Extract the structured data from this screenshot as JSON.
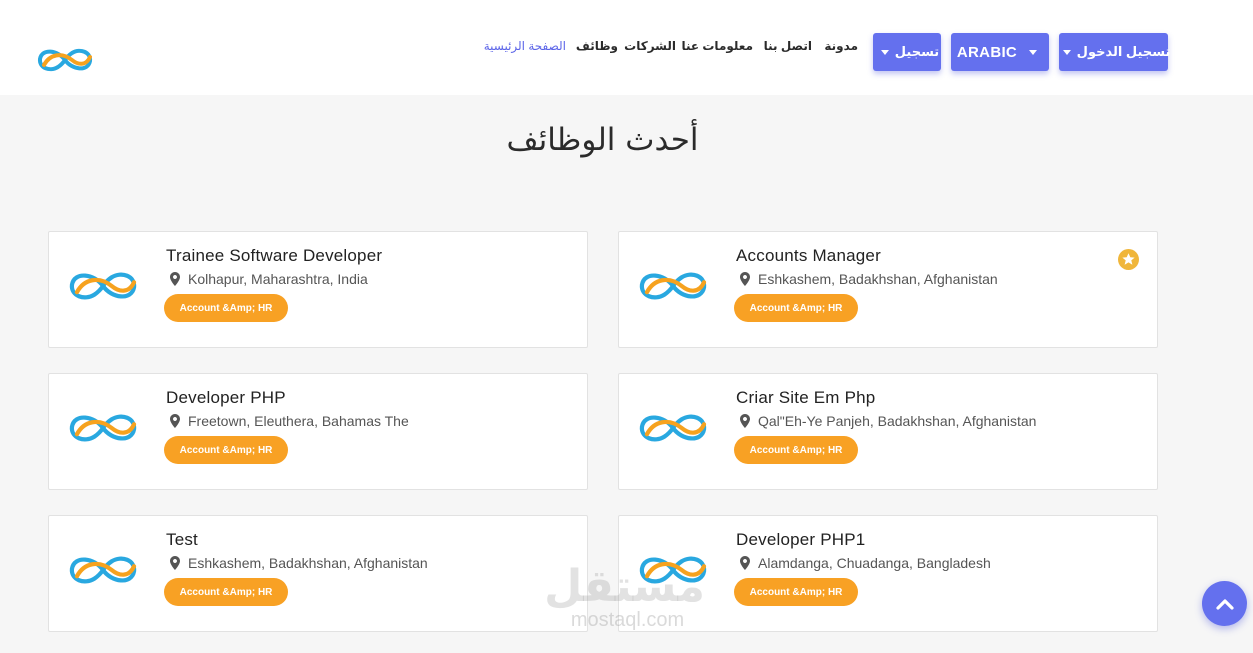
{
  "header": {
    "nav": {
      "home": "الصفحة الرئيسية",
      "jobs": "وظائف",
      "companies": "الشركات",
      "about": "معلومات عنا",
      "contact": "اتصل بنا",
      "blog": "مدونة"
    },
    "buttons": {
      "register": "تسجيل",
      "language": "ARABIC",
      "login": "تسجيل الدخول"
    }
  },
  "main": {
    "title": "أحدث الوظائف",
    "jobs": [
      {
        "title": "Trainee Software Developer",
        "location": "Kolhapur, Maharashtra, India",
        "category": "Account &Amp; HR",
        "featured": false
      },
      {
        "title": "Accounts Manager",
        "location": "Eshkashem, Badakhshan, Afghanistan",
        "category": "Account &Amp; HR",
        "featured": true
      },
      {
        "title": "Developer PHP",
        "location": "Freetown, Eleuthera, Bahamas The",
        "category": "Account &Amp; HR",
        "featured": false
      },
      {
        "title": "Criar Site Em Php",
        "location": "Qal\"Eh-Ye Panjeh, Badakhshan, Afghanistan",
        "category": "Account &Amp; HR",
        "featured": false
      },
      {
        "title": "Test",
        "location": "Eshkashem, Badakhshan, Afghanistan",
        "category": "Account &Amp; HR",
        "featured": false
      },
      {
        "title": "Developer PHP1",
        "location": "Alamdanga, Chuadanga, Bangladesh",
        "category": "Account &Amp; HR",
        "featured": false
      }
    ]
  },
  "watermark": {
    "arabic": "مستقل",
    "latin": "mostaql.com"
  },
  "colors": {
    "primary": "#6470ee",
    "tag": "#f8a124",
    "star": "#f0b63a",
    "logo_orange": "#f6a21e",
    "logo_blue": "#29a8e0"
  },
  "icons": {
    "back_to_top": "chevron-up-icon",
    "location": "map-pin-icon",
    "featured": "star-badge-icon"
  }
}
